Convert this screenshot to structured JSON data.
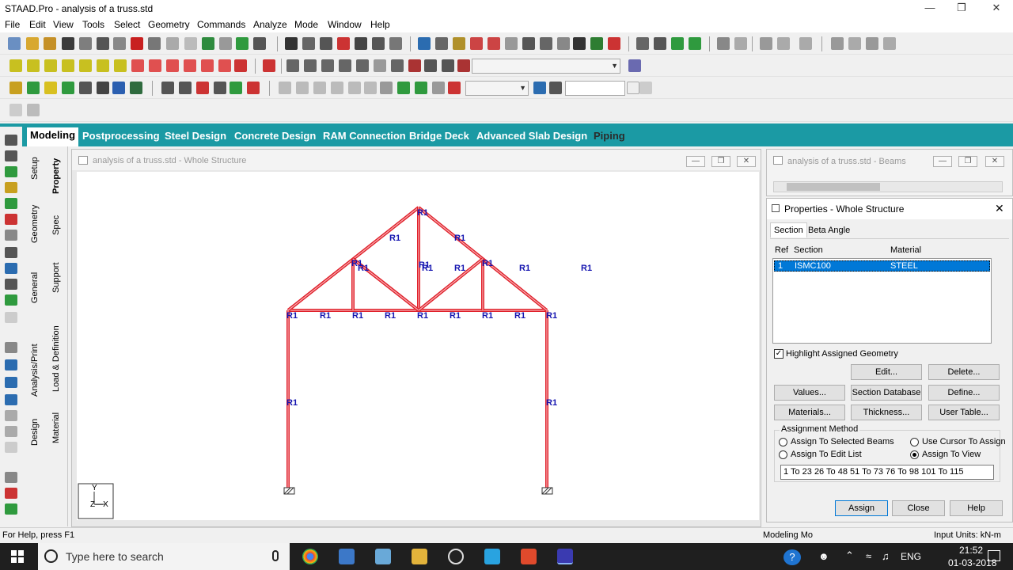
{
  "app": {
    "title": "STAAD.Pro - analysis of a truss.std"
  },
  "menu": [
    "File",
    "Edit",
    "View",
    "Tools",
    "Select",
    "Geometry",
    "Commands",
    "Analyze",
    "Mode",
    "Window",
    "Help"
  ],
  "page_tabs": [
    "Modeling",
    "Postprocessing",
    "Steel Design",
    "Concrete Design",
    "RAM Connection",
    "Bridge Deck",
    "Advanced Slab Design",
    "Piping"
  ],
  "side_tabs": {
    "outer": [
      "Setup",
      "Geometry",
      "General",
      "Analysis/Print",
      "Design"
    ],
    "inner": [
      "Property",
      "Spec",
      "Support",
      "Load & Definition",
      "Material"
    ]
  },
  "view_window": {
    "title": "analysis of a truss.std - Whole Structure"
  },
  "beams_window": {
    "title": "analysis of a truss.std - Beams"
  },
  "member_label": "R1",
  "axis": {
    "y": "Y",
    "zx": "Z—X"
  },
  "properties": {
    "title": "Properties - Whole Structure",
    "tabs": [
      "Section",
      "Beta Angle"
    ],
    "columns": {
      "ref": "Ref",
      "section": "Section",
      "material": "Material"
    },
    "rows": [
      {
        "ref": "1",
        "section": "ISMC100",
        "material": "STEEL"
      }
    ],
    "highlight_label": "Highlight Assigned Geometry",
    "highlight_checked": true,
    "buttons": {
      "edit": "Edit...",
      "delete": "Delete...",
      "values": "Values...",
      "section_db": "Section Database",
      "define": "Define...",
      "materials": "Materials...",
      "thickness": "Thickness...",
      "user_table": "User Table..."
    },
    "assign_method": {
      "legend": "Assignment Method",
      "selected_beams": "Assign To Selected Beams",
      "edit_list": "Assign To Edit List",
      "use_cursor": "Use Cursor To Assign",
      "to_view": "Assign To View",
      "selected": "to_view"
    },
    "list_value": "1 To 23 26 To 48 51 To 73 76 To 98 101 To 115",
    "footer": {
      "assign": "Assign",
      "close": "Close",
      "help": "Help"
    }
  },
  "status": {
    "left": "For Help, press F1",
    "mode": "Modeling Mo",
    "units": "Input Units:  kN-m"
  },
  "taskbar": {
    "search_placeholder": "Type here to search",
    "lang": "ENG",
    "time": "21:52",
    "date": "01-03-2018"
  },
  "colors": {
    "teal": "#1b9aa4",
    "truss": "#e0202a",
    "label": "#1515b0",
    "selection": "#0078d7"
  }
}
